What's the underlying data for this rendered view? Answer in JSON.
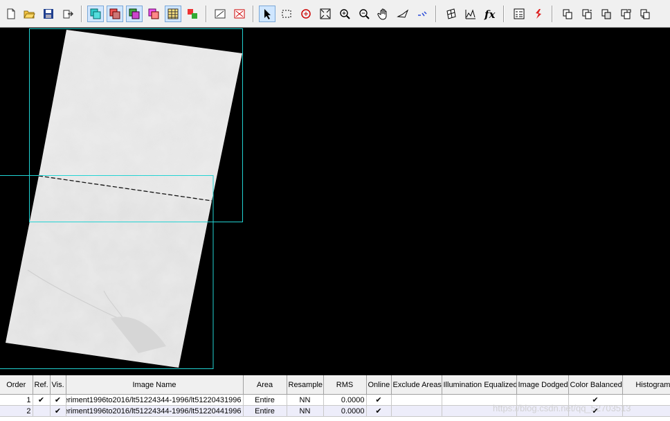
{
  "toolbar": {
    "buttons": [
      {
        "icon": "new-document-icon",
        "pressed": false
      },
      {
        "icon": "open-folder-icon",
        "pressed": false
      },
      {
        "icon": "save-icon",
        "pressed": false
      },
      {
        "icon": "export-icon",
        "pressed": false
      },
      {
        "icon": "layer-stack-cyan-icon",
        "pressed": true
      },
      {
        "icon": "layer-stack-red-icon",
        "pressed": true
      },
      {
        "icon": "layer-stack-green-icon",
        "pressed": true
      },
      {
        "icon": "layer-stack-magenta-icon",
        "pressed": false
      },
      {
        "icon": "grid-table-icon",
        "pressed": true
      },
      {
        "icon": "color-blocks-icon",
        "pressed": false
      },
      {
        "icon": "crop-corner-icon",
        "pressed": false
      },
      {
        "icon": "exclude-area-icon",
        "pressed": false
      },
      {
        "icon": "select-arrow-icon",
        "pressed": true
      },
      {
        "icon": "select-rectangle-icon",
        "pressed": false
      },
      {
        "icon": "rotate-icon",
        "pressed": false
      },
      {
        "icon": "fit-to-window-icon",
        "pressed": false
      },
      {
        "icon": "zoom-in-icon",
        "pressed": false
      },
      {
        "icon": "zoom-out-icon",
        "pressed": false
      },
      {
        "icon": "pan-hand-icon",
        "pressed": false
      },
      {
        "icon": "polygon-tool-icon",
        "pressed": false
      },
      {
        "icon": "seamline-icon",
        "pressed": false
      },
      {
        "icon": "mosaic-grid-icon",
        "pressed": false
      },
      {
        "icon": "histogram-icon",
        "pressed": false
      },
      {
        "icon": "function-icon",
        "pressed": false
      },
      {
        "icon": "properties-list-icon",
        "pressed": false
      },
      {
        "icon": "pin-icon",
        "pressed": false
      },
      {
        "icon": "output-1-icon",
        "pressed": false
      },
      {
        "icon": "output-2-icon",
        "pressed": false
      },
      {
        "icon": "output-3-icon",
        "pressed": false
      },
      {
        "icon": "output-4-icon",
        "pressed": false
      },
      {
        "icon": "output-5-icon",
        "pressed": false
      }
    ]
  },
  "colors": {
    "footprint": "#22d3d3",
    "canvas_bg": "#000000",
    "image_fill": "#e4e4e4"
  },
  "table": {
    "headers": [
      "Order",
      "Ref.",
      "Vis.",
      "Image Name",
      "Area",
      "Resample",
      "RMS",
      "Online",
      "Exclude Areas",
      "Illumination Equalized",
      "Image Dodged",
      "Color Balanced",
      "Histogram M"
    ],
    "rows": [
      {
        "order": "1",
        "ref": "✔",
        "vis": "✔",
        "name": "eriment1996to2016/lt51224344-1996/lt51220431996",
        "area": "Entire",
        "resample": "NN",
        "rms": "0.0000",
        "online": "✔",
        "exclude": "",
        "illum": "",
        "dodged": "",
        "balanced": "✔",
        "hist": ""
      },
      {
        "order": "2",
        "ref": "",
        "vis": "✔",
        "name": "eriment1996to2016/lt51224344-1996/lt51220441996",
        "area": "Entire",
        "resample": "NN",
        "rms": "0.0000",
        "online": "✔",
        "exclude": "",
        "illum": "",
        "dodged": "",
        "balanced": "✔",
        "hist": ""
      }
    ]
  },
  "watermark": "https://blog.csdn.net/qq_52703513"
}
